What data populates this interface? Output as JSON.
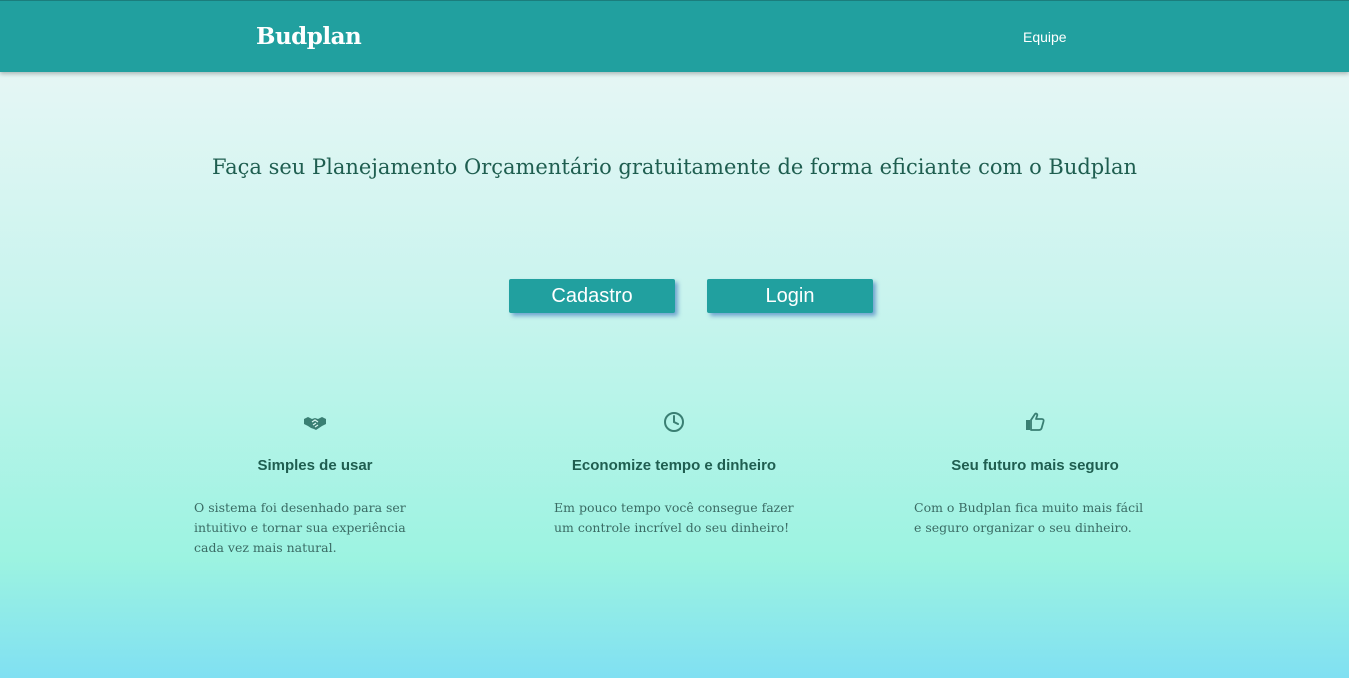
{
  "navbar": {
    "brand": "Budplan",
    "links": [
      "Equipe"
    ]
  },
  "hero": {
    "headline": "Faça seu Planejamento Orçamentário gratuitamente de forma eficiante com o Budplan",
    "buttons": {
      "cadastro": "Cadastro",
      "login": "Login"
    }
  },
  "features": [
    {
      "icon": "handshake-icon",
      "title": "Simples de usar",
      "text": "O sistema foi desenhado para ser intuitivo e tornar sua experiência cada vez mais natural."
    },
    {
      "icon": "clock-icon",
      "title": "Economize tempo e dinheiro",
      "text": "Em pouco tempo você consegue fazer um controle incrível do seu dinheiro!"
    },
    {
      "icon": "thumbs-up-icon",
      "title": "Seu futuro mais seguro",
      "text": "Com o Budplan fica muito mais fácil e seguro organizar o seu dinheiro."
    }
  ],
  "colors": {
    "primary": "#21a09f",
    "text_dark": "#1f5e50",
    "text_body": "#3a6b64"
  }
}
